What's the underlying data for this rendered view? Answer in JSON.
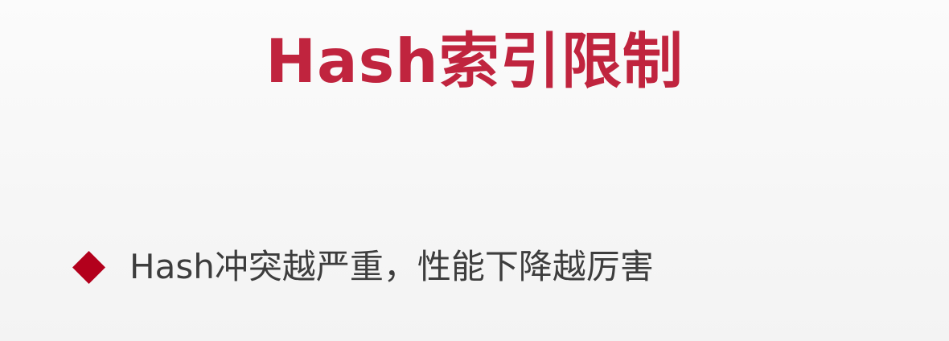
{
  "slide": {
    "title": "Hash索引限制",
    "bullets": [
      {
        "text": "Hash冲突越严重，性能下降越厉害"
      }
    ]
  },
  "colors": {
    "title": "#c0243e",
    "bullet_marker": "#b3001c",
    "body_text": "#3d3d3d",
    "background": "#f7f7f7"
  },
  "icons": {
    "bullet": "diamond-icon"
  }
}
